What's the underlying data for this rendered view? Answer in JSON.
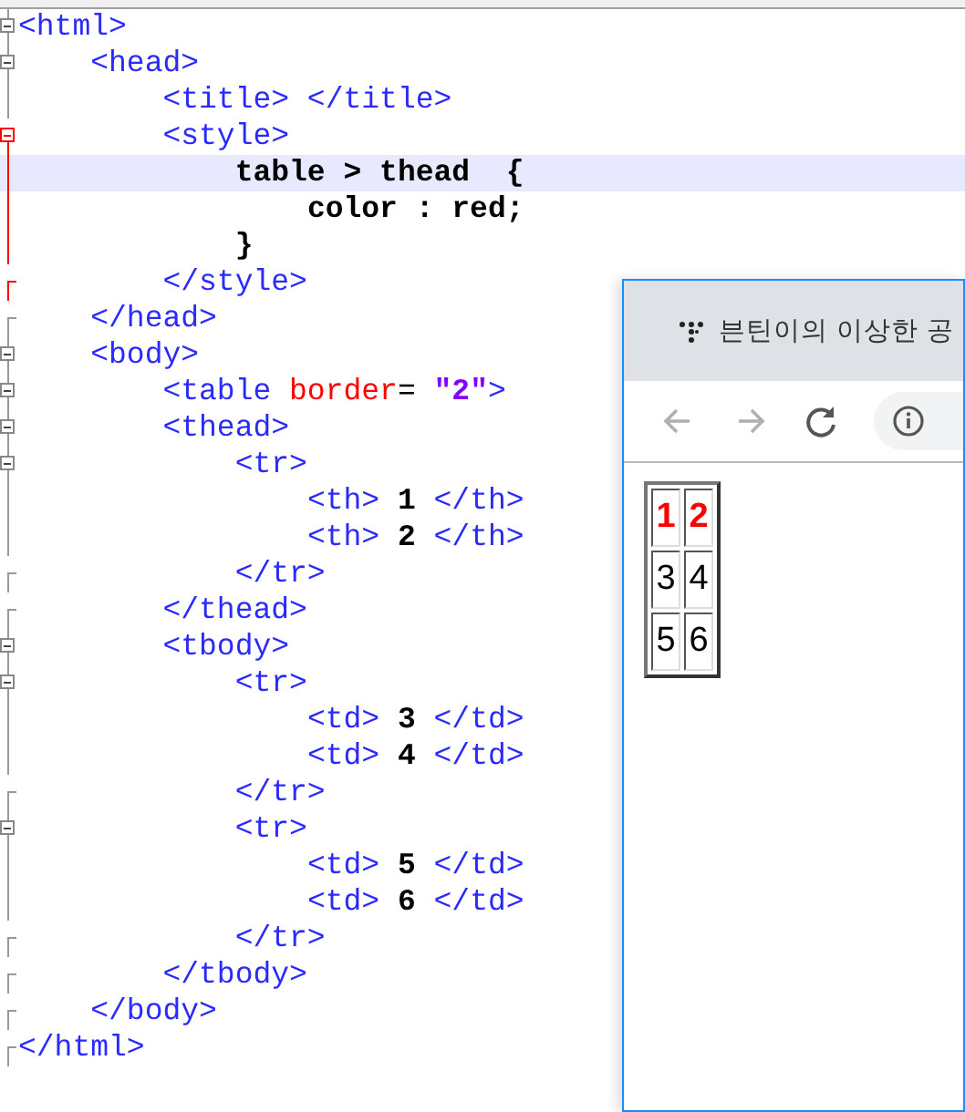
{
  "editor": {
    "lines": [
      {
        "kind": "open",
        "highlighted": false,
        "tokens": [
          {
            "kind": "tag",
            "text": "<html>"
          }
        ]
      },
      {
        "kind": "open",
        "highlighted": false,
        "tokens": [
          {
            "kind": "tag",
            "text": "    <head>"
          }
        ]
      },
      {
        "kind": "inner",
        "highlighted": false,
        "tokens": [
          {
            "kind": "tag",
            "text": "        <title> </title>"
          }
        ]
      },
      {
        "kind": "open-red",
        "highlighted": false,
        "tokens": [
          {
            "kind": "tag",
            "text": "        <style>"
          }
        ]
      },
      {
        "kind": "inner-red",
        "highlighted": true,
        "tokens": [
          {
            "kind": "text",
            "text": "            table > thead  {"
          }
        ]
      },
      {
        "kind": "inner-red",
        "highlighted": false,
        "tokens": [
          {
            "kind": "text",
            "text": "                color : red;"
          }
        ]
      },
      {
        "kind": "inner-red",
        "highlighted": false,
        "tokens": [
          {
            "kind": "text",
            "text": "            }"
          }
        ]
      },
      {
        "kind": "end-red",
        "highlighted": false,
        "tokens": [
          {
            "kind": "tag",
            "text": "        </style>"
          }
        ]
      },
      {
        "kind": "end",
        "highlighted": false,
        "tokens": [
          {
            "kind": "tag",
            "text": "    </head>"
          }
        ]
      },
      {
        "kind": "open",
        "highlighted": false,
        "tokens": [
          {
            "kind": "tag",
            "text": "    <body>"
          }
        ]
      },
      {
        "kind": "open",
        "highlighted": false,
        "tokens": [
          {
            "kind": "tag",
            "text": "        <table "
          },
          {
            "kind": "attr",
            "text": "border"
          },
          {
            "kind": "plain",
            "text": "= "
          },
          {
            "kind": "value",
            "text": "\"2\""
          },
          {
            "kind": "tag",
            "text": ">"
          }
        ]
      },
      {
        "kind": "open",
        "highlighted": false,
        "tokens": [
          {
            "kind": "tag",
            "text": "        <thead>"
          }
        ]
      },
      {
        "kind": "open",
        "highlighted": false,
        "tokens": [
          {
            "kind": "tag",
            "text": "            <tr>"
          }
        ]
      },
      {
        "kind": "inner",
        "highlighted": false,
        "tokens": [
          {
            "kind": "tag",
            "text": "                <th> "
          },
          {
            "kind": "text",
            "text": "1"
          },
          {
            "kind": "tag",
            "text": " </th>"
          }
        ]
      },
      {
        "kind": "inner",
        "highlighted": false,
        "tokens": [
          {
            "kind": "tag",
            "text": "                <th> "
          },
          {
            "kind": "text",
            "text": "2"
          },
          {
            "kind": "tag",
            "text": " </th>"
          }
        ]
      },
      {
        "kind": "end",
        "highlighted": false,
        "tokens": [
          {
            "kind": "tag",
            "text": "            </tr>"
          }
        ]
      },
      {
        "kind": "end",
        "highlighted": false,
        "tokens": [
          {
            "kind": "tag",
            "text": "        </thead>"
          }
        ]
      },
      {
        "kind": "open",
        "highlighted": false,
        "tokens": [
          {
            "kind": "tag",
            "text": "        <tbody>"
          }
        ]
      },
      {
        "kind": "open",
        "highlighted": false,
        "tokens": [
          {
            "kind": "tag",
            "text": "            <tr>"
          }
        ]
      },
      {
        "kind": "inner",
        "highlighted": false,
        "tokens": [
          {
            "kind": "tag",
            "text": "                <td> "
          },
          {
            "kind": "text",
            "text": "3"
          },
          {
            "kind": "tag",
            "text": " </td>"
          }
        ]
      },
      {
        "kind": "inner",
        "highlighted": false,
        "tokens": [
          {
            "kind": "tag",
            "text": "                <td> "
          },
          {
            "kind": "text",
            "text": "4"
          },
          {
            "kind": "tag",
            "text": " </td>"
          }
        ]
      },
      {
        "kind": "end",
        "highlighted": false,
        "tokens": [
          {
            "kind": "tag",
            "text": "            </tr>"
          }
        ]
      },
      {
        "kind": "open",
        "highlighted": false,
        "tokens": [
          {
            "kind": "tag",
            "text": "            <tr>"
          }
        ]
      },
      {
        "kind": "inner",
        "highlighted": false,
        "tokens": [
          {
            "kind": "tag",
            "text": "                <td> "
          },
          {
            "kind": "text",
            "text": "5"
          },
          {
            "kind": "tag",
            "text": " </td>"
          }
        ]
      },
      {
        "kind": "inner",
        "highlighted": false,
        "tokens": [
          {
            "kind": "tag",
            "text": "                <td> "
          },
          {
            "kind": "text",
            "text": "6"
          },
          {
            "kind": "tag",
            "text": " </td>"
          }
        ]
      },
      {
        "kind": "end",
        "highlighted": false,
        "tokens": [
          {
            "kind": "tag",
            "text": "            </tr>"
          }
        ]
      },
      {
        "kind": "end",
        "highlighted": false,
        "tokens": [
          {
            "kind": "tag",
            "text": "        </tbody>"
          }
        ]
      },
      {
        "kind": "end",
        "highlighted": false,
        "tokens": [
          {
            "kind": "tag",
            "text": "    </body>"
          }
        ]
      },
      {
        "kind": "end",
        "highlighted": false,
        "tokens": [
          {
            "kind": "tag",
            "text": "</html>"
          }
        ]
      }
    ]
  },
  "browser": {
    "tab_title": "븐틴이의 이상한 공",
    "nav": [
      {
        "kind": "back",
        "disabled": true
      },
      {
        "kind": "forward",
        "disabled": true
      },
      {
        "kind": "reload",
        "disabled": false
      }
    ],
    "table": {
      "header": [
        "1",
        "2"
      ],
      "rows": [
        [
          "3",
          "4"
        ],
        [
          "5",
          "6"
        ]
      ]
    }
  }
}
